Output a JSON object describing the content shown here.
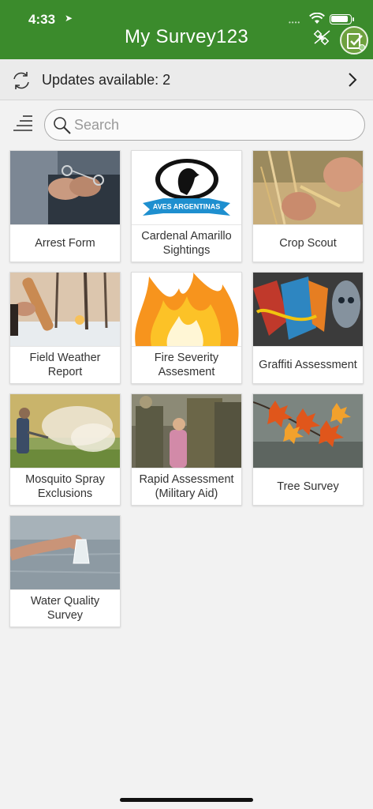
{
  "status": {
    "time": "4:33"
  },
  "header": {
    "title": "My Survey123"
  },
  "updates": {
    "label": "Updates available: 2"
  },
  "search": {
    "placeholder": "Search",
    "value": ""
  },
  "surveys": [
    {
      "label": "Arrest Form",
      "icon": "arrest-form-thumbnail"
    },
    {
      "label": "Cardenal Amarillo Sightings",
      "icon": "aves-argentinas-logo",
      "logo_text": "AVES ARGENTINAS"
    },
    {
      "label": "Crop Scout",
      "icon": "crop-scout-thumbnail"
    },
    {
      "label": "Field Weather Report",
      "icon": "field-weather-thumbnail"
    },
    {
      "label": "Fire Severity Assesment",
      "icon": "fire-severity-thumbnail"
    },
    {
      "label": "Graffiti Assessment",
      "icon": "graffiti-thumbnail"
    },
    {
      "label": "Mosquito Spray Exclusions",
      "icon": "mosquito-spray-thumbnail"
    },
    {
      "label": "Rapid Assessment (Military Aid)",
      "icon": "rapid-assessment-thumbnail"
    },
    {
      "label": "Tree Survey",
      "icon": "tree-survey-thumbnail"
    },
    {
      "label": "Water Quality Survey",
      "icon": "water-quality-thumbnail"
    }
  ],
  "colors": {
    "header": "#3b8b2c",
    "background": "#f2f2f2"
  }
}
